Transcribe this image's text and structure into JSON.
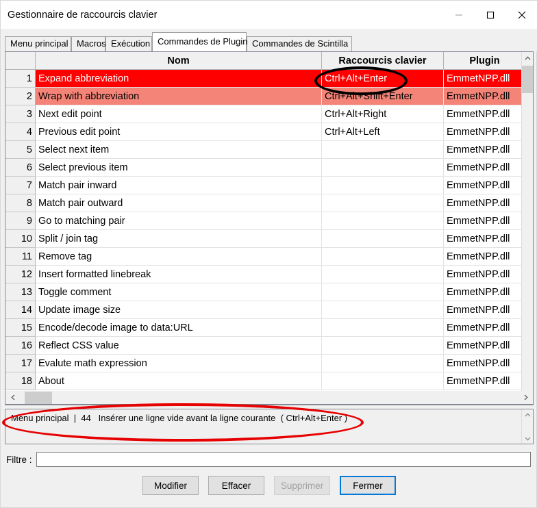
{
  "window": {
    "title": "Gestionnaire de raccourcis clavier",
    "minimize_label": "minimize-icon",
    "maximize_label": "maximize-icon",
    "close_label": "close-icon"
  },
  "tabs": [
    {
      "label": "Menu principal",
      "active": false
    },
    {
      "label": "Macros",
      "active": false
    },
    {
      "label": "Exécution",
      "active": false
    },
    {
      "label": "Commandes de Plugin",
      "active": true
    },
    {
      "label": "Commandes de Scintilla",
      "active": false
    }
  ],
  "table": {
    "columns": [
      "",
      "Nom",
      "Raccourcis clavier",
      "Plugin"
    ],
    "rows": [
      {
        "num": "1",
        "nom": "Expand abbreviation",
        "key": "Ctrl+Alt+Enter",
        "plugin": "EmmetNPP.dll",
        "state": "sel-primary"
      },
      {
        "num": "2",
        "nom": "Wrap with abbreviation",
        "key": "Ctrl+Alt+Shift+Enter",
        "plugin": "EmmetNPP.dll",
        "state": "sel-secondary"
      },
      {
        "num": "3",
        "nom": "Next edit point",
        "key": "Ctrl+Alt+Right",
        "plugin": "EmmetNPP.dll",
        "state": ""
      },
      {
        "num": "4",
        "nom": "Previous edit point",
        "key": "Ctrl+Alt+Left",
        "plugin": "EmmetNPP.dll",
        "state": ""
      },
      {
        "num": "5",
        "nom": "Select next item",
        "key": "",
        "plugin": "EmmetNPP.dll",
        "state": ""
      },
      {
        "num": "6",
        "nom": "Select previous item",
        "key": "",
        "plugin": "EmmetNPP.dll",
        "state": ""
      },
      {
        "num": "7",
        "nom": "Match pair inward",
        "key": "",
        "plugin": "EmmetNPP.dll",
        "state": ""
      },
      {
        "num": "8",
        "nom": "Match pair outward",
        "key": "",
        "plugin": "EmmetNPP.dll",
        "state": ""
      },
      {
        "num": "9",
        "nom": "Go to matching pair",
        "key": "",
        "plugin": "EmmetNPP.dll",
        "state": ""
      },
      {
        "num": "10",
        "nom": "Split / join tag",
        "key": "",
        "plugin": "EmmetNPP.dll",
        "state": ""
      },
      {
        "num": "11",
        "nom": "Remove tag",
        "key": "",
        "plugin": "EmmetNPP.dll",
        "state": ""
      },
      {
        "num": "12",
        "nom": "Insert formatted linebreak",
        "key": "",
        "plugin": "EmmetNPP.dll",
        "state": ""
      },
      {
        "num": "13",
        "nom": "Toggle comment",
        "key": "",
        "plugin": "EmmetNPP.dll",
        "state": ""
      },
      {
        "num": "14",
        "nom": "Update image size",
        "key": "",
        "plugin": "EmmetNPP.dll",
        "state": ""
      },
      {
        "num": "15",
        "nom": "Encode/decode image to data:URL",
        "key": "",
        "plugin": "EmmetNPP.dll",
        "state": ""
      },
      {
        "num": "16",
        "nom": "Reflect CSS value",
        "key": "",
        "plugin": "EmmetNPP.dll",
        "state": ""
      },
      {
        "num": "17",
        "nom": "Evalute math expression",
        "key": "",
        "plugin": "EmmetNPP.dll",
        "state": ""
      },
      {
        "num": "18",
        "nom": "About",
        "key": "",
        "plugin": "EmmetNPP.dll",
        "state": ""
      }
    ]
  },
  "info": {
    "text": "Menu principal  |  44   Insérer une ligne vide avant la ligne courante  ( Ctrl+Alt+Enter )"
  },
  "filter": {
    "label": "Filtre :",
    "value": "",
    "placeholder": ""
  },
  "buttons": [
    {
      "label": "Modifier",
      "state": ""
    },
    {
      "label": "Effacer",
      "state": ""
    },
    {
      "label": "Supprimer",
      "state": "disabled"
    },
    {
      "label": "Fermer",
      "state": "default"
    }
  ],
  "colors": {
    "selected_primary": "#ff0000",
    "selected_secondary": "#f58478",
    "focus_border": "#0078d7",
    "annotation_black": "#000000",
    "annotation_red": "#e60000"
  },
  "annotations": [
    {
      "name": "ellipse-around-shortcut",
      "shape": "ellipse",
      "color": "#000000"
    },
    {
      "name": "ellipse-around-status-text",
      "shape": "ellipse",
      "color": "#e60000"
    }
  ]
}
